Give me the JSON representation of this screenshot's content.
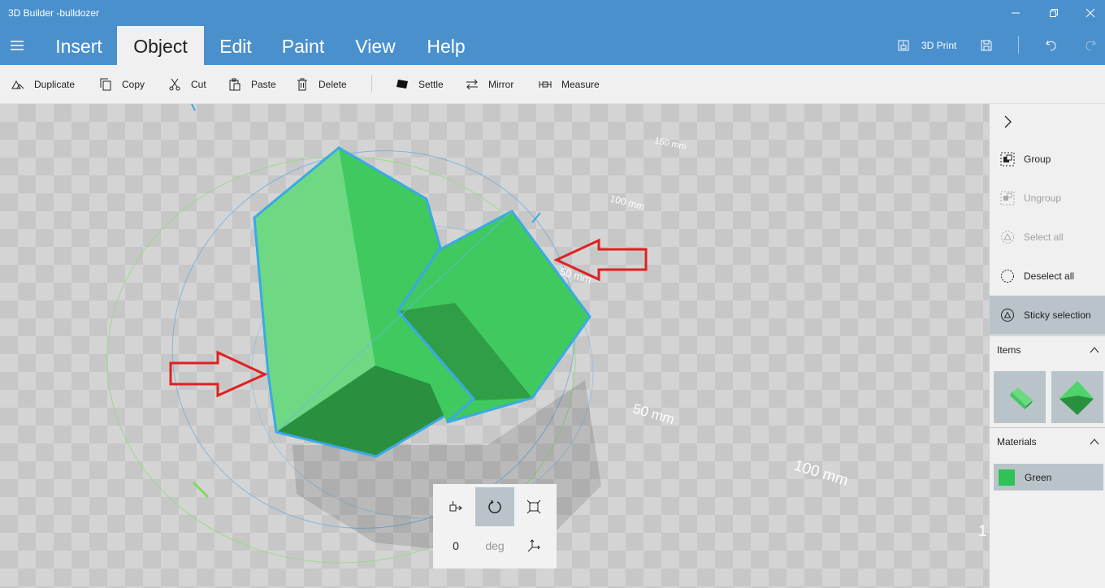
{
  "window": {
    "title": "3D Builder -bulldozer",
    "controls": [
      "minimize-icon",
      "restore-icon",
      "close-icon"
    ]
  },
  "menu": {
    "tabs": [
      {
        "label": "Insert"
      },
      {
        "label": "Object",
        "active": true
      },
      {
        "label": "Edit"
      },
      {
        "label": "Paint"
      },
      {
        "label": "View"
      },
      {
        "label": "Help"
      }
    ],
    "print_label": "3D Print"
  },
  "toolbar": {
    "items": [
      {
        "label": "Duplicate",
        "icon": "duplicate-icon"
      },
      {
        "label": "Copy",
        "icon": "copy-icon"
      },
      {
        "label": "Cut",
        "icon": "scissors-icon"
      },
      {
        "label": "Paste",
        "icon": "paste-icon"
      },
      {
        "label": "Delete",
        "icon": "trash-icon"
      },
      {
        "label": "Settle",
        "icon": "settle-icon"
      },
      {
        "label": "Mirror",
        "icon": "mirror-icon"
      },
      {
        "label": "Measure",
        "icon": "ruler-icon"
      }
    ]
  },
  "viewport": {
    "scale_labels": [
      "150 mm",
      "100 mm",
      "50 mm",
      "50 mm",
      "100 mm"
    ],
    "edge_label": "1",
    "object_color": "#3fc95e",
    "selection_color": "#3aa9e6",
    "annotation_arrow_color": "#e02020"
  },
  "transform": {
    "value": "0",
    "unit": "deg"
  },
  "sidepanel": {
    "items": [
      {
        "label": "Group",
        "icon": "group-icon",
        "enabled": true
      },
      {
        "label": "Ungroup",
        "icon": "ungroup-icon",
        "enabled": false
      },
      {
        "label": "Select all",
        "icon": "select-all-icon",
        "enabled": false
      },
      {
        "label": "Deselect all",
        "icon": "deselect-icon",
        "enabled": true
      },
      {
        "label": "Sticky selection",
        "icon": "sticky-selection-icon",
        "enabled": true,
        "active": true
      }
    ],
    "items_title": "Items",
    "materials_title": "Materials",
    "material": {
      "name": "Green",
      "color": "#2fc255"
    }
  }
}
